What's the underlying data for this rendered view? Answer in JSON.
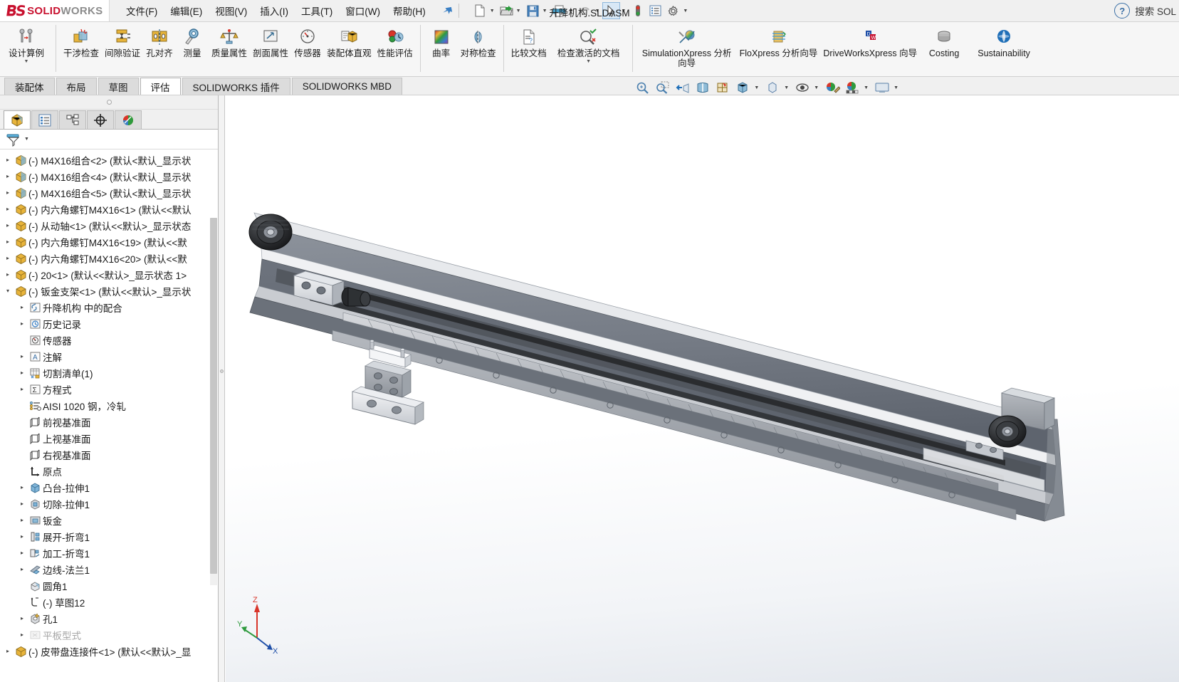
{
  "app": {
    "brand_ds": "2S",
    "brand_solid": "SOLID",
    "brand_works": "WORKS",
    "document_title": "升降机构.SLDASM",
    "search_text": "搜索 SOL",
    "accent_red": "#c8102e",
    "accent_blue": "#3a7fc4"
  },
  "menu": {
    "items": [
      {
        "label": "文件(F)",
        "name": "menu-file"
      },
      {
        "label": "编辑(E)",
        "name": "menu-edit"
      },
      {
        "label": "视图(V)",
        "name": "menu-view"
      },
      {
        "label": "插入(I)",
        "name": "menu-insert"
      },
      {
        "label": "工具(T)",
        "name": "menu-tools"
      },
      {
        "label": "窗口(W)",
        "name": "menu-window"
      },
      {
        "label": "帮助(H)",
        "name": "menu-help"
      }
    ]
  },
  "quick_access": {
    "icons": [
      "new-document-icon",
      "open-folder-icon",
      "save-icon",
      "print-icon",
      "undo-icon",
      "select-cursor-icon",
      "rebuild-traffic-light-icon",
      "options-list-icon",
      "gear-icon"
    ]
  },
  "ribbon": {
    "groups": [
      {
        "name": "design-study-group",
        "buttons": [
          {
            "label": "设计算例",
            "icon": "design-study-icon",
            "dropdown": true,
            "wide": true
          }
        ]
      },
      {
        "name": "evaluate-tools-group",
        "buttons": [
          {
            "label": "干涉检查",
            "icon": "interference-check-icon",
            "dropdown": false
          },
          {
            "label": "间隙验证",
            "icon": "clearance-verification-icon",
            "dropdown": false
          },
          {
            "label": "孔对齐",
            "icon": "hole-alignment-icon",
            "dropdown": false
          },
          {
            "label": "测量",
            "icon": "measure-icon",
            "dropdown": false
          },
          {
            "label": "质量属性",
            "icon": "mass-properties-icon",
            "dropdown": false
          },
          {
            "label": "剖面属性",
            "icon": "section-properties-icon",
            "dropdown": false
          },
          {
            "label": "传感器",
            "icon": "sensor-icon",
            "dropdown": false
          },
          {
            "label": "装配体直观",
            "icon": "assembly-visualization-icon",
            "dropdown": false
          },
          {
            "label": "性能评估",
            "icon": "performance-evaluation-icon",
            "dropdown": false
          }
        ]
      },
      {
        "name": "curvature-group",
        "buttons": [
          {
            "label": "曲率",
            "icon": "curvature-icon",
            "dropdown": false
          },
          {
            "label": "对称检查",
            "icon": "symmetry-check-icon",
            "dropdown": false
          }
        ]
      },
      {
        "name": "compare-group",
        "buttons": [
          {
            "label": "比较文档",
            "icon": "compare-documents-icon",
            "dropdown": false
          },
          {
            "label": "检查激活的文档",
            "icon": "check-active-document-icon",
            "dropdown": true,
            "wide": true
          }
        ]
      },
      {
        "name": "xpress-group",
        "buttons": [
          {
            "label": "SimulationXpress 分析向导",
            "icon": "simulationxpress-icon",
            "dropdown": false,
            "wide": true
          },
          {
            "label": "FloXpress 分析向导",
            "icon": "floxpress-icon",
            "dropdown": false,
            "wide": true
          },
          {
            "label": "DriveWorksXpress 向导",
            "icon": "driveworksxpress-icon",
            "dropdown": false,
            "wide": true
          },
          {
            "label": "Costing",
            "icon": "costing-icon",
            "dropdown": false,
            "wide": true
          },
          {
            "label": "Sustainability",
            "icon": "sustainability-icon",
            "dropdown": false,
            "wide": true
          }
        ]
      }
    ]
  },
  "command_tabs": {
    "items": [
      {
        "label": "装配体",
        "active": false,
        "name": "tab-assembly"
      },
      {
        "label": "布局",
        "active": false,
        "name": "tab-layout"
      },
      {
        "label": "草图",
        "active": false,
        "name": "tab-sketch"
      },
      {
        "label": "评估",
        "active": true,
        "name": "tab-evaluate"
      },
      {
        "label": "SOLIDWORKS 插件",
        "active": false,
        "name": "tab-addins"
      },
      {
        "label": "SOLIDWORKS MBD",
        "active": false,
        "name": "tab-mbd"
      }
    ]
  },
  "view_toolbar": {
    "icons": [
      "zoom-to-fit-icon",
      "zoom-to-area-icon",
      "previous-view-icon",
      "section-view-icon",
      "view-orientation-icon",
      "display-style-icon",
      "hide-show-items-icon",
      "edit-appearance-icon",
      "apply-scene-icon",
      "view-settings-icon"
    ]
  },
  "panel_tabs": {
    "items": [
      {
        "name": "feature-manager-tab",
        "icon": "feature-tree-icon",
        "active": true
      },
      {
        "name": "property-manager-tab",
        "icon": "property-list-icon",
        "active": false
      },
      {
        "name": "configuration-manager-tab",
        "icon": "configuration-icon",
        "active": false
      },
      {
        "name": "dimxpert-manager-tab",
        "icon": "crosshair-icon",
        "active": false
      },
      {
        "name": "display-manager-tab",
        "icon": "appearance-ball-icon",
        "active": false
      }
    ]
  },
  "filter_bar": {
    "icon": "filter-funnel-icon"
  },
  "tree": {
    "rows": [
      {
        "label": "(-) M4X16组合<2> (默认<默认_显示状",
        "indent": 0,
        "arrow": "collapsed",
        "icon": "part-blue-icon",
        "dim": false
      },
      {
        "label": "(-) M4X16组合<4> (默认<默认_显示状",
        "indent": 0,
        "arrow": "collapsed",
        "icon": "part-blue-icon",
        "dim": false
      },
      {
        "label": "(-) M4X16组合<5> (默认<默认_显示状",
        "indent": 0,
        "arrow": "collapsed",
        "icon": "part-blue-icon",
        "dim": false
      },
      {
        "label": "(-) 内六角螺钉M4X16<1> (默认<<默认",
        "indent": 0,
        "arrow": "collapsed",
        "icon": "part-yellow-icon",
        "dim": false
      },
      {
        "label": "(-) 从动轴<1> (默认<<默认>_显示状态",
        "indent": 0,
        "arrow": "collapsed",
        "icon": "part-yellow-icon",
        "dim": false
      },
      {
        "label": "(-) 内六角螺钉M4X16<19> (默认<<默",
        "indent": 0,
        "arrow": "collapsed",
        "icon": "part-yellow-icon",
        "dim": false
      },
      {
        "label": "(-) 内六角螺钉M4X16<20> (默认<<默",
        "indent": 0,
        "arrow": "collapsed",
        "icon": "part-yellow-icon",
        "dim": false
      },
      {
        "label": "(-) 20<1> (默认<<默认>_显示状态 1>",
        "indent": 0,
        "arrow": "collapsed",
        "icon": "part-yellow-icon",
        "dim": false
      },
      {
        "label": "(-) 钣金支架<1> (默认<<默认>_显示状",
        "indent": 0,
        "arrow": "expanded",
        "icon": "part-yellow-icon",
        "dim": false
      },
      {
        "label": "升降机构 中的配合",
        "indent": 1,
        "arrow": "collapsed",
        "icon": "mates-folder-icon",
        "dim": false
      },
      {
        "label": "历史记录",
        "indent": 1,
        "arrow": "collapsed",
        "icon": "history-icon",
        "dim": false
      },
      {
        "label": "传感器",
        "indent": 1,
        "arrow": "none",
        "icon": "sensors-icon",
        "dim": false
      },
      {
        "label": "注解",
        "indent": 1,
        "arrow": "collapsed",
        "icon": "annotations-icon",
        "dim": false
      },
      {
        "label": "切割清单(1)",
        "indent": 1,
        "arrow": "collapsed",
        "icon": "cutlist-icon",
        "dim": false
      },
      {
        "label": "方程式",
        "indent": 1,
        "arrow": "collapsed",
        "icon": "equations-icon",
        "dim": false
      },
      {
        "label": "AISI 1020 钢，冷轧",
        "indent": 1,
        "arrow": "none",
        "icon": "material-icon",
        "dim": false
      },
      {
        "label": "前视基准面",
        "indent": 1,
        "arrow": "none",
        "icon": "plane-icon",
        "dim": false
      },
      {
        "label": "上视基准面",
        "indent": 1,
        "arrow": "none",
        "icon": "plane-icon",
        "dim": false
      },
      {
        "label": "右视基准面",
        "indent": 1,
        "arrow": "none",
        "icon": "plane-icon",
        "dim": false
      },
      {
        "label": "原点",
        "indent": 1,
        "arrow": "none",
        "icon": "origin-icon",
        "dim": false
      },
      {
        "label": "凸台-拉伸1",
        "indent": 1,
        "arrow": "collapsed",
        "icon": "boss-extrude-icon",
        "dim": false
      },
      {
        "label": "切除-拉伸1",
        "indent": 1,
        "arrow": "collapsed",
        "icon": "cut-extrude-icon",
        "dim": false
      },
      {
        "label": "钣金",
        "indent": 1,
        "arrow": "collapsed",
        "icon": "sheetmetal-icon",
        "dim": false
      },
      {
        "label": "展开-折弯1",
        "indent": 1,
        "arrow": "collapsed",
        "icon": "unfold-bend-icon",
        "dim": false
      },
      {
        "label": "加工-折弯1",
        "indent": 1,
        "arrow": "collapsed",
        "icon": "process-bend-icon",
        "dim": false
      },
      {
        "label": "边线-法兰1",
        "indent": 1,
        "arrow": "collapsed",
        "icon": "edge-flange-icon",
        "dim": false
      },
      {
        "label": "圆角1",
        "indent": 1,
        "arrow": "none",
        "icon": "fillet-icon",
        "dim": false
      },
      {
        "label": "(-) 草图12",
        "indent": 1,
        "arrow": "none",
        "icon": "sketch-icon",
        "dim": false
      },
      {
        "label": "孔1",
        "indent": 1,
        "arrow": "collapsed",
        "icon": "hole-wizard-icon",
        "dim": false
      },
      {
        "label": "平板型式",
        "indent": 1,
        "arrow": "collapsed",
        "icon": "flat-pattern-icon",
        "dim": true
      },
      {
        "label": "(-) 皮带盘连接件<1> (默认<<默认>_显",
        "indent": 0,
        "arrow": "collapsed",
        "icon": "part-yellow-icon",
        "dim": false
      }
    ]
  },
  "graphics": {
    "model_name": "升降机构",
    "triad": {
      "x_label": "X",
      "y_label": "Y",
      "z_label": "Z"
    }
  }
}
